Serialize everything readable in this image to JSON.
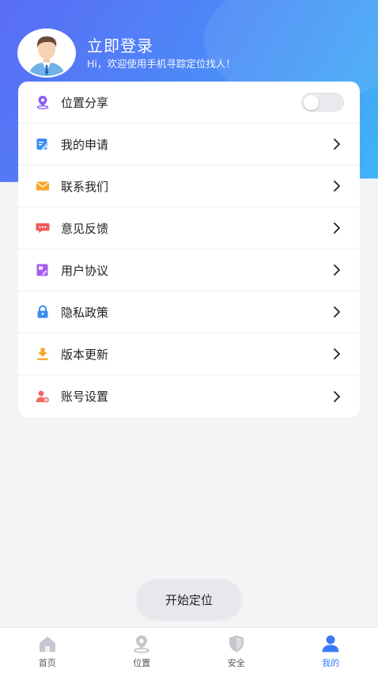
{
  "header": {
    "title": "立即登录",
    "greeting": "Hi，欢迎使用手机寻踪定位找人！"
  },
  "menu": {
    "items": [
      {
        "label": "位置分享",
        "icon": "location-pin-icon",
        "color": "#8a5cf6",
        "type": "toggle",
        "toggle_on": false
      },
      {
        "label": "我的申请",
        "icon": "edit-document-icon",
        "color": "#3a8cf5",
        "type": "link"
      },
      {
        "label": "联系我们",
        "icon": "mail-envelope-icon",
        "color": "#f5a623",
        "type": "link"
      },
      {
        "label": "意见反馈",
        "icon": "chat-bubble-icon",
        "color": "#f25b5b",
        "type": "link"
      },
      {
        "label": "用户协议",
        "icon": "agreement-icon",
        "color": "#a65cf0",
        "type": "link"
      },
      {
        "label": "隐私政策",
        "icon": "lock-icon",
        "color": "#3a8cf5",
        "type": "link"
      },
      {
        "label": "版本更新",
        "icon": "download-icon",
        "color": "#f5a623",
        "type": "link"
      },
      {
        "label": "账号设置",
        "icon": "user-settings-icon",
        "color": "#ef6a6a",
        "type": "link"
      }
    ]
  },
  "start_button": "开始定位",
  "tabbar": {
    "tabs": [
      {
        "label": "首页",
        "icon": "home-icon",
        "active": false
      },
      {
        "label": "位置",
        "icon": "location-tab-icon",
        "active": false
      },
      {
        "label": "安全",
        "icon": "shield-icon",
        "active": false
      },
      {
        "label": "我的",
        "icon": "person-icon",
        "active": true
      }
    ],
    "active_color": "#3a7bf5",
    "inactive_color": "#c4c7cd"
  },
  "colors": {
    "header_gradient_start": "#5a6cf6",
    "header_gradient_end": "#3fb4f7"
  }
}
